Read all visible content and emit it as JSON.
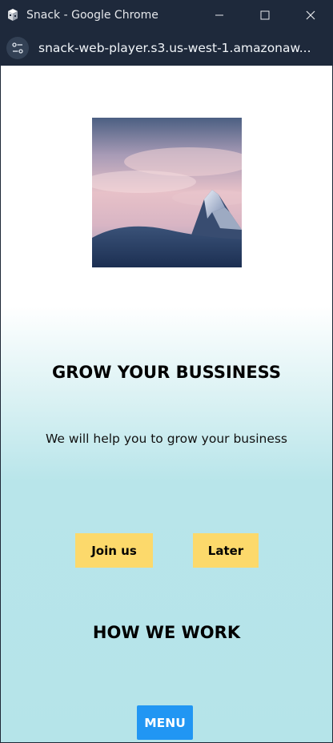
{
  "window": {
    "title": "Snack - Google Chrome",
    "url": "snack-web-player.s3.us-west-1.amazonaw..."
  },
  "hero": {
    "image_description_icon": "mountain-photo"
  },
  "content": {
    "headline": "GROW YOUR BUSSINESS",
    "subline": "We will help you to grow your business",
    "join_label": "Join us",
    "later_label": "Later",
    "section_title": "HOW WE WORK",
    "menu_label": "MENU"
  },
  "colors": {
    "button_yellow": "#fcd96b",
    "menu_blue": "#2196f3",
    "background_cyan": "#b5e4e9",
    "chrome_dark": "#1e293b"
  }
}
